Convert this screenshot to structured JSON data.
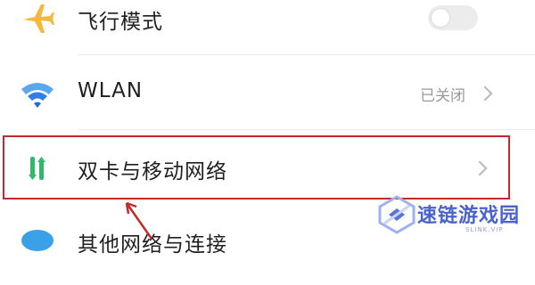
{
  "settings": {
    "rows": [
      {
        "id": "airplane",
        "label": "飞行模式",
        "icon": "airplane-icon",
        "toggle_state": "off"
      },
      {
        "id": "wlan",
        "label": "WLAN",
        "value": "已关闭",
        "icon": "wifi-icon"
      },
      {
        "id": "dual",
        "label": "双卡与移动网络",
        "icon": "dual-sim-icon"
      },
      {
        "id": "other",
        "label": "其他网络与连接",
        "icon": "network-icon"
      }
    ]
  },
  "annotation": {
    "highlight_color": "#c32a2a"
  },
  "watermark": {
    "title": "速链游戏园",
    "subtitle": "SLINK.VIP",
    "color": "#4a63c8"
  },
  "colors": {
    "airplane_icon": "#f5b83b",
    "wifi_icon": "#2f7fe6",
    "dual_sim_green": "#2fba6b"
  }
}
